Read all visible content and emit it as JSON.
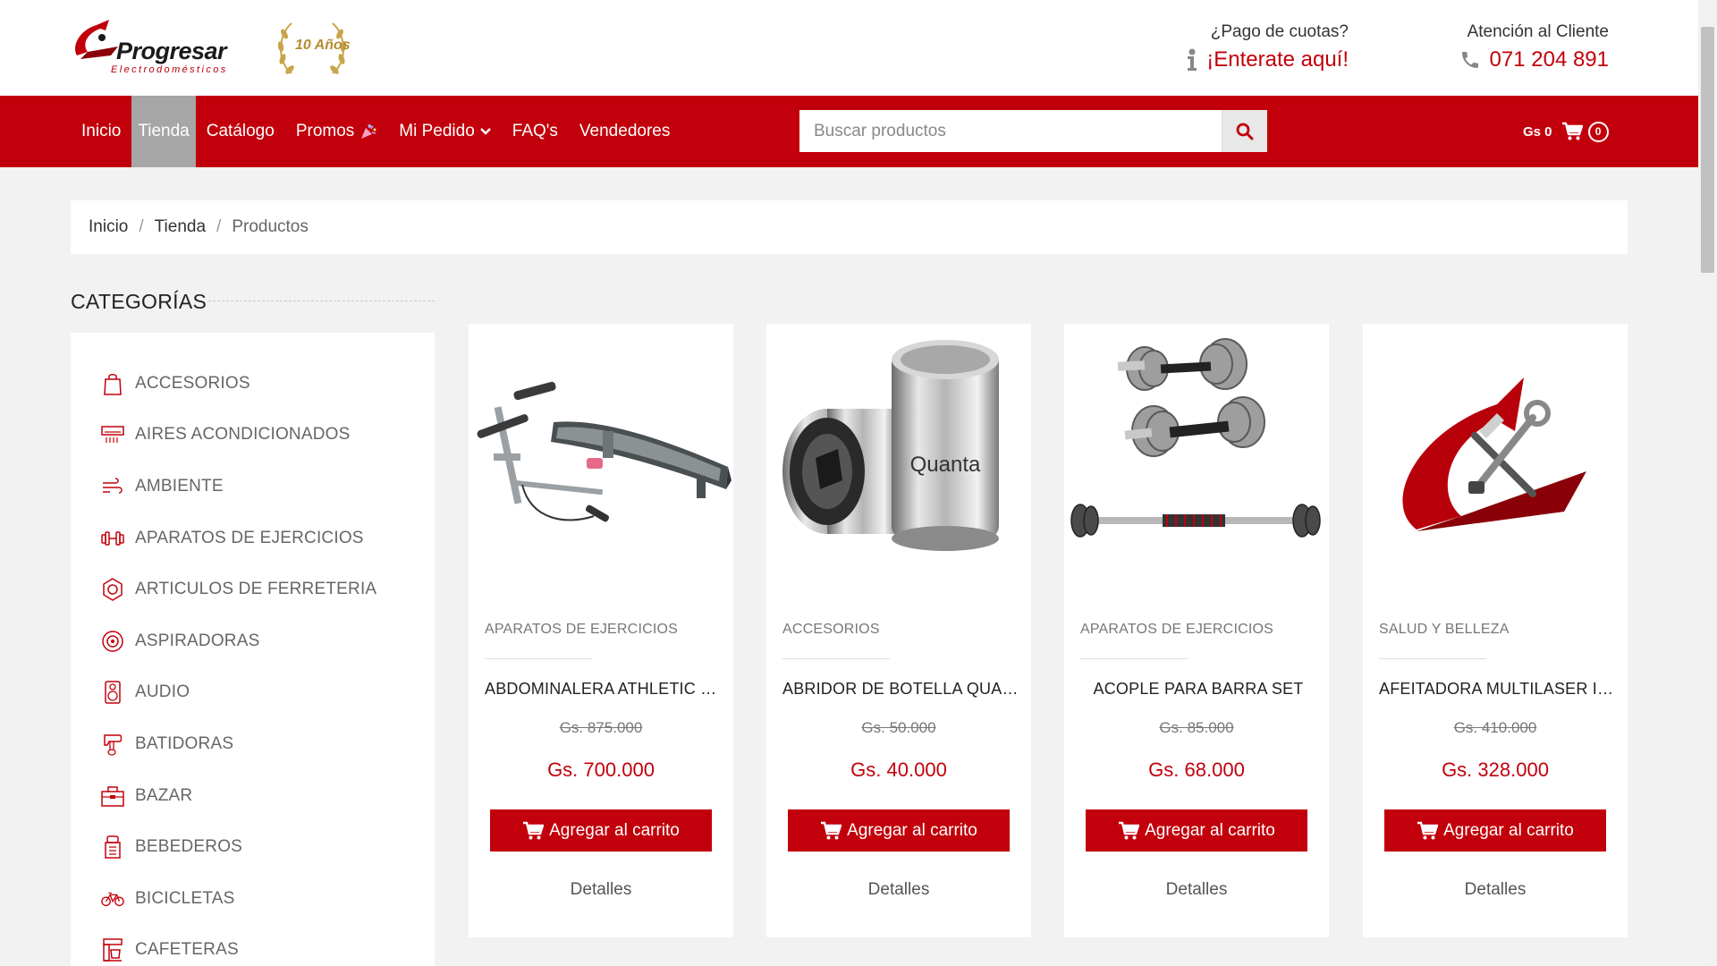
{
  "header": {
    "brand": "Progresar",
    "brand_sub": "Electrodomésticos",
    "anniversary": "10 Años",
    "pago_question": "¿Pago de cuotas?",
    "pago_link": "¡Enterate aquí!",
    "atencion_title": "Atención al Cliente",
    "phone": "071 204 891"
  },
  "nav": {
    "items": [
      {
        "label": "Inicio",
        "active": false
      },
      {
        "label": "Tienda",
        "active": true
      },
      {
        "label": "Catálogo",
        "active": false
      },
      {
        "label": "Promos",
        "active": false
      },
      {
        "label": "Mi Pedido",
        "active": false
      },
      {
        "label": "FAQ's",
        "active": false
      },
      {
        "label": "Vendedores",
        "active": false
      }
    ],
    "search_placeholder": "Buscar productos",
    "cart_amount": "Gs 0",
    "cart_count": "0"
  },
  "breadcrumb": {
    "items": [
      "Inicio",
      "Tienda",
      "Productos"
    ]
  },
  "sidebar": {
    "title": "CATEGORÍAS",
    "categories": [
      {
        "label": "ACCESORIOS",
        "icon": "bag-icon"
      },
      {
        "label": "AIRES ACONDICIONADOS",
        "icon": "air-conditioner-icon"
      },
      {
        "label": "AMBIENTE",
        "icon": "wind-icon"
      },
      {
        "label": "APARATOS DE EJERCICIOS",
        "icon": "dumbbell-icon"
      },
      {
        "label": "ARTICULOS DE FERRETERIA",
        "icon": "nut-icon"
      },
      {
        "label": "ASPIRADORAS",
        "icon": "vacuum-icon"
      },
      {
        "label": "AUDIO",
        "icon": "speaker-icon"
      },
      {
        "label": "BATIDORAS",
        "icon": "mixer-icon"
      },
      {
        "label": "BAZAR",
        "icon": "toolbox-icon"
      },
      {
        "label": "BEBEDEROS",
        "icon": "water-cooler-icon"
      },
      {
        "label": "BICICLETAS",
        "icon": "bicycle-icon"
      },
      {
        "label": "CAFETERAS",
        "icon": "coffee-maker-icon"
      }
    ]
  },
  "products": [
    {
      "category": "APARATOS DE EJERCICIOS",
      "name": "ABDOMINALERA ATHLETIC SIT UP",
      "old_price": "Gs. 875.000",
      "price": "Gs. 700.000",
      "add_label": "Agregar al carrito",
      "details_label": "Detalles",
      "image": "bench-image"
    },
    {
      "category": "ACCESORIOS",
      "name": "ABRIDOR DE BOTELLA QUANTA",
      "old_price": "Gs. 50.000",
      "price": "Gs. 40.000",
      "add_label": "Agregar al carrito",
      "details_label": "Detalles",
      "image": "bottle-opener-image"
    },
    {
      "category": "APARATOS DE EJERCICIOS",
      "name": "ACOPLE PARA BARRA SET",
      "old_price": "Gs. 85.000",
      "price": "Gs. 68.000",
      "add_label": "Agregar al carrito",
      "details_label": "Detalles",
      "image": "dumbbell-set-image"
    },
    {
      "category": "SALUD Y BELLEZA",
      "name": "AFEITADORA MULTILASER INOX",
      "old_price": "Gs. 410.000",
      "price": "Gs. 328.000",
      "add_label": "Agregar al carrito",
      "details_label": "Detalles",
      "image": "placeholder-logo-image"
    }
  ],
  "colors": {
    "brand_red": "#c2000b",
    "nav_active": "#a6a6a6",
    "page_bg": "#f2f2f2"
  }
}
